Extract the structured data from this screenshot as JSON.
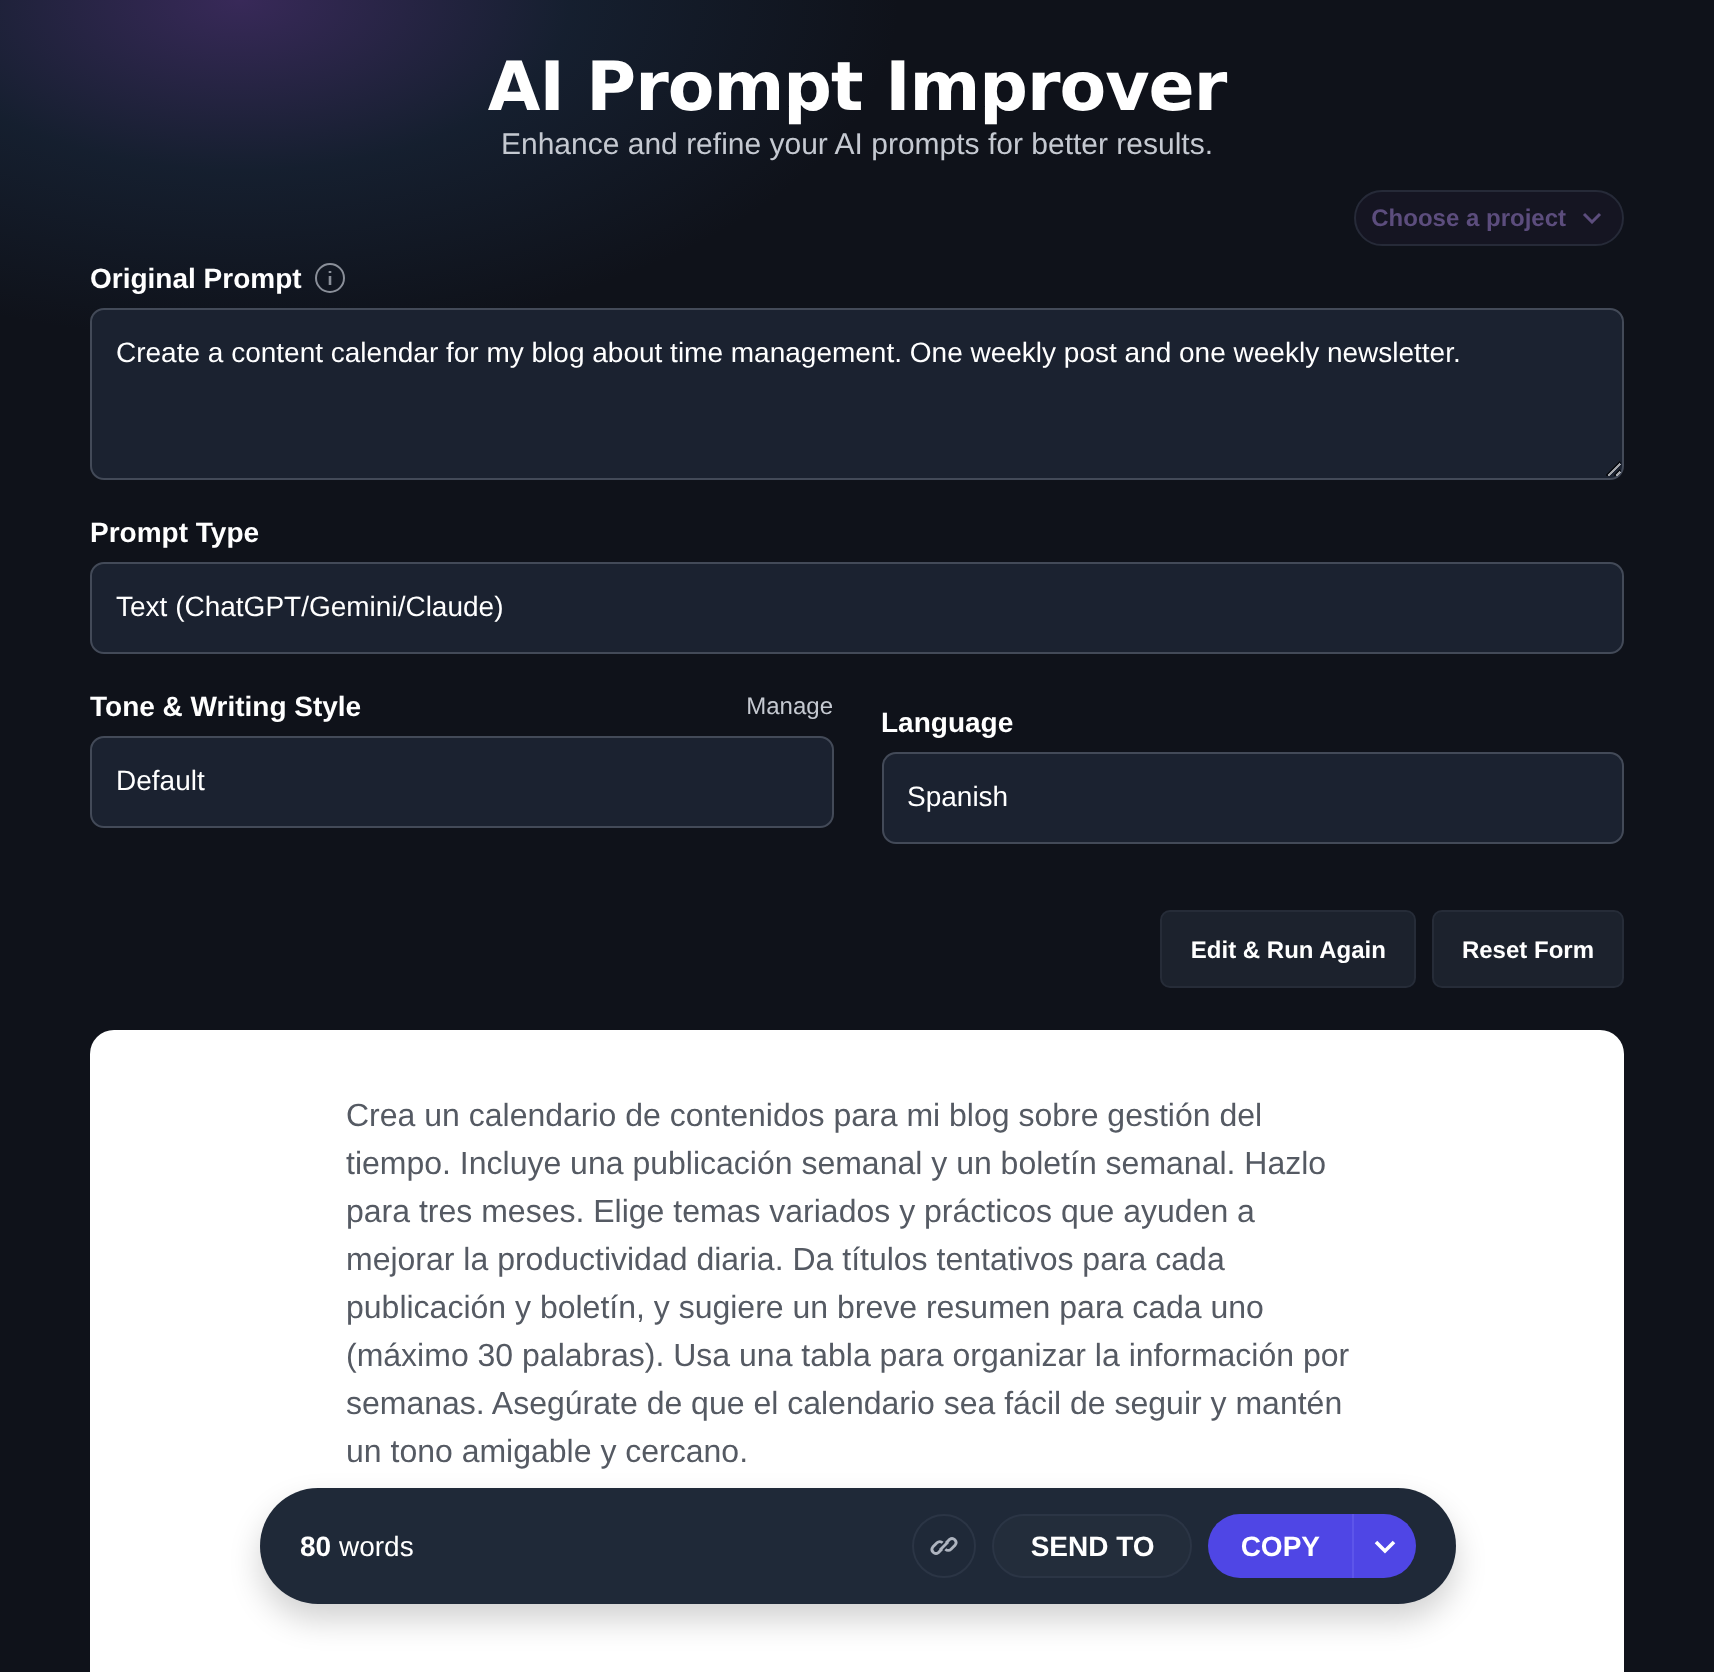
{
  "header": {
    "title": "AI Prompt Improver",
    "subtitle": "Enhance and refine your AI prompts for better results."
  },
  "project_select": {
    "placeholder": "Choose a project"
  },
  "original_prompt": {
    "label": "Original Prompt",
    "value": "Create a content calendar for my blog about time management. One weekly post and one weekly newsletter."
  },
  "prompt_type": {
    "label": "Prompt Type",
    "value": "Text (ChatGPT/Gemini/Claude)"
  },
  "tone": {
    "label": "Tone & Writing Style",
    "link": "Manage",
    "value": "Default"
  },
  "language": {
    "label": "Language",
    "value": "Spanish"
  },
  "buttons": [
    "Edit & Run Again",
    "Reset Form"
  ],
  "result": {
    "text": "Crea un calendario de contenidos para mi blog sobre gestión del tiempo. Incluye una publicación semanal y un boletín semanal. Hazlo para tres meses. Elige temas variados y prácticos que ayuden a mejorar la productividad diaria. Da títulos tentativos para cada publicación y boletín, y sugiere un breve resumen para cada uno (máximo 30 palabras). Usa una tabla para organizar la información por semanas. Asegúrate de que el calendario sea fácil de seguir y mantén un tono amigable y cercano."
  },
  "action_bar": {
    "word_count": "**80** words",
    "send_to": "SEND TO",
    "copy": "COPY"
  }
}
